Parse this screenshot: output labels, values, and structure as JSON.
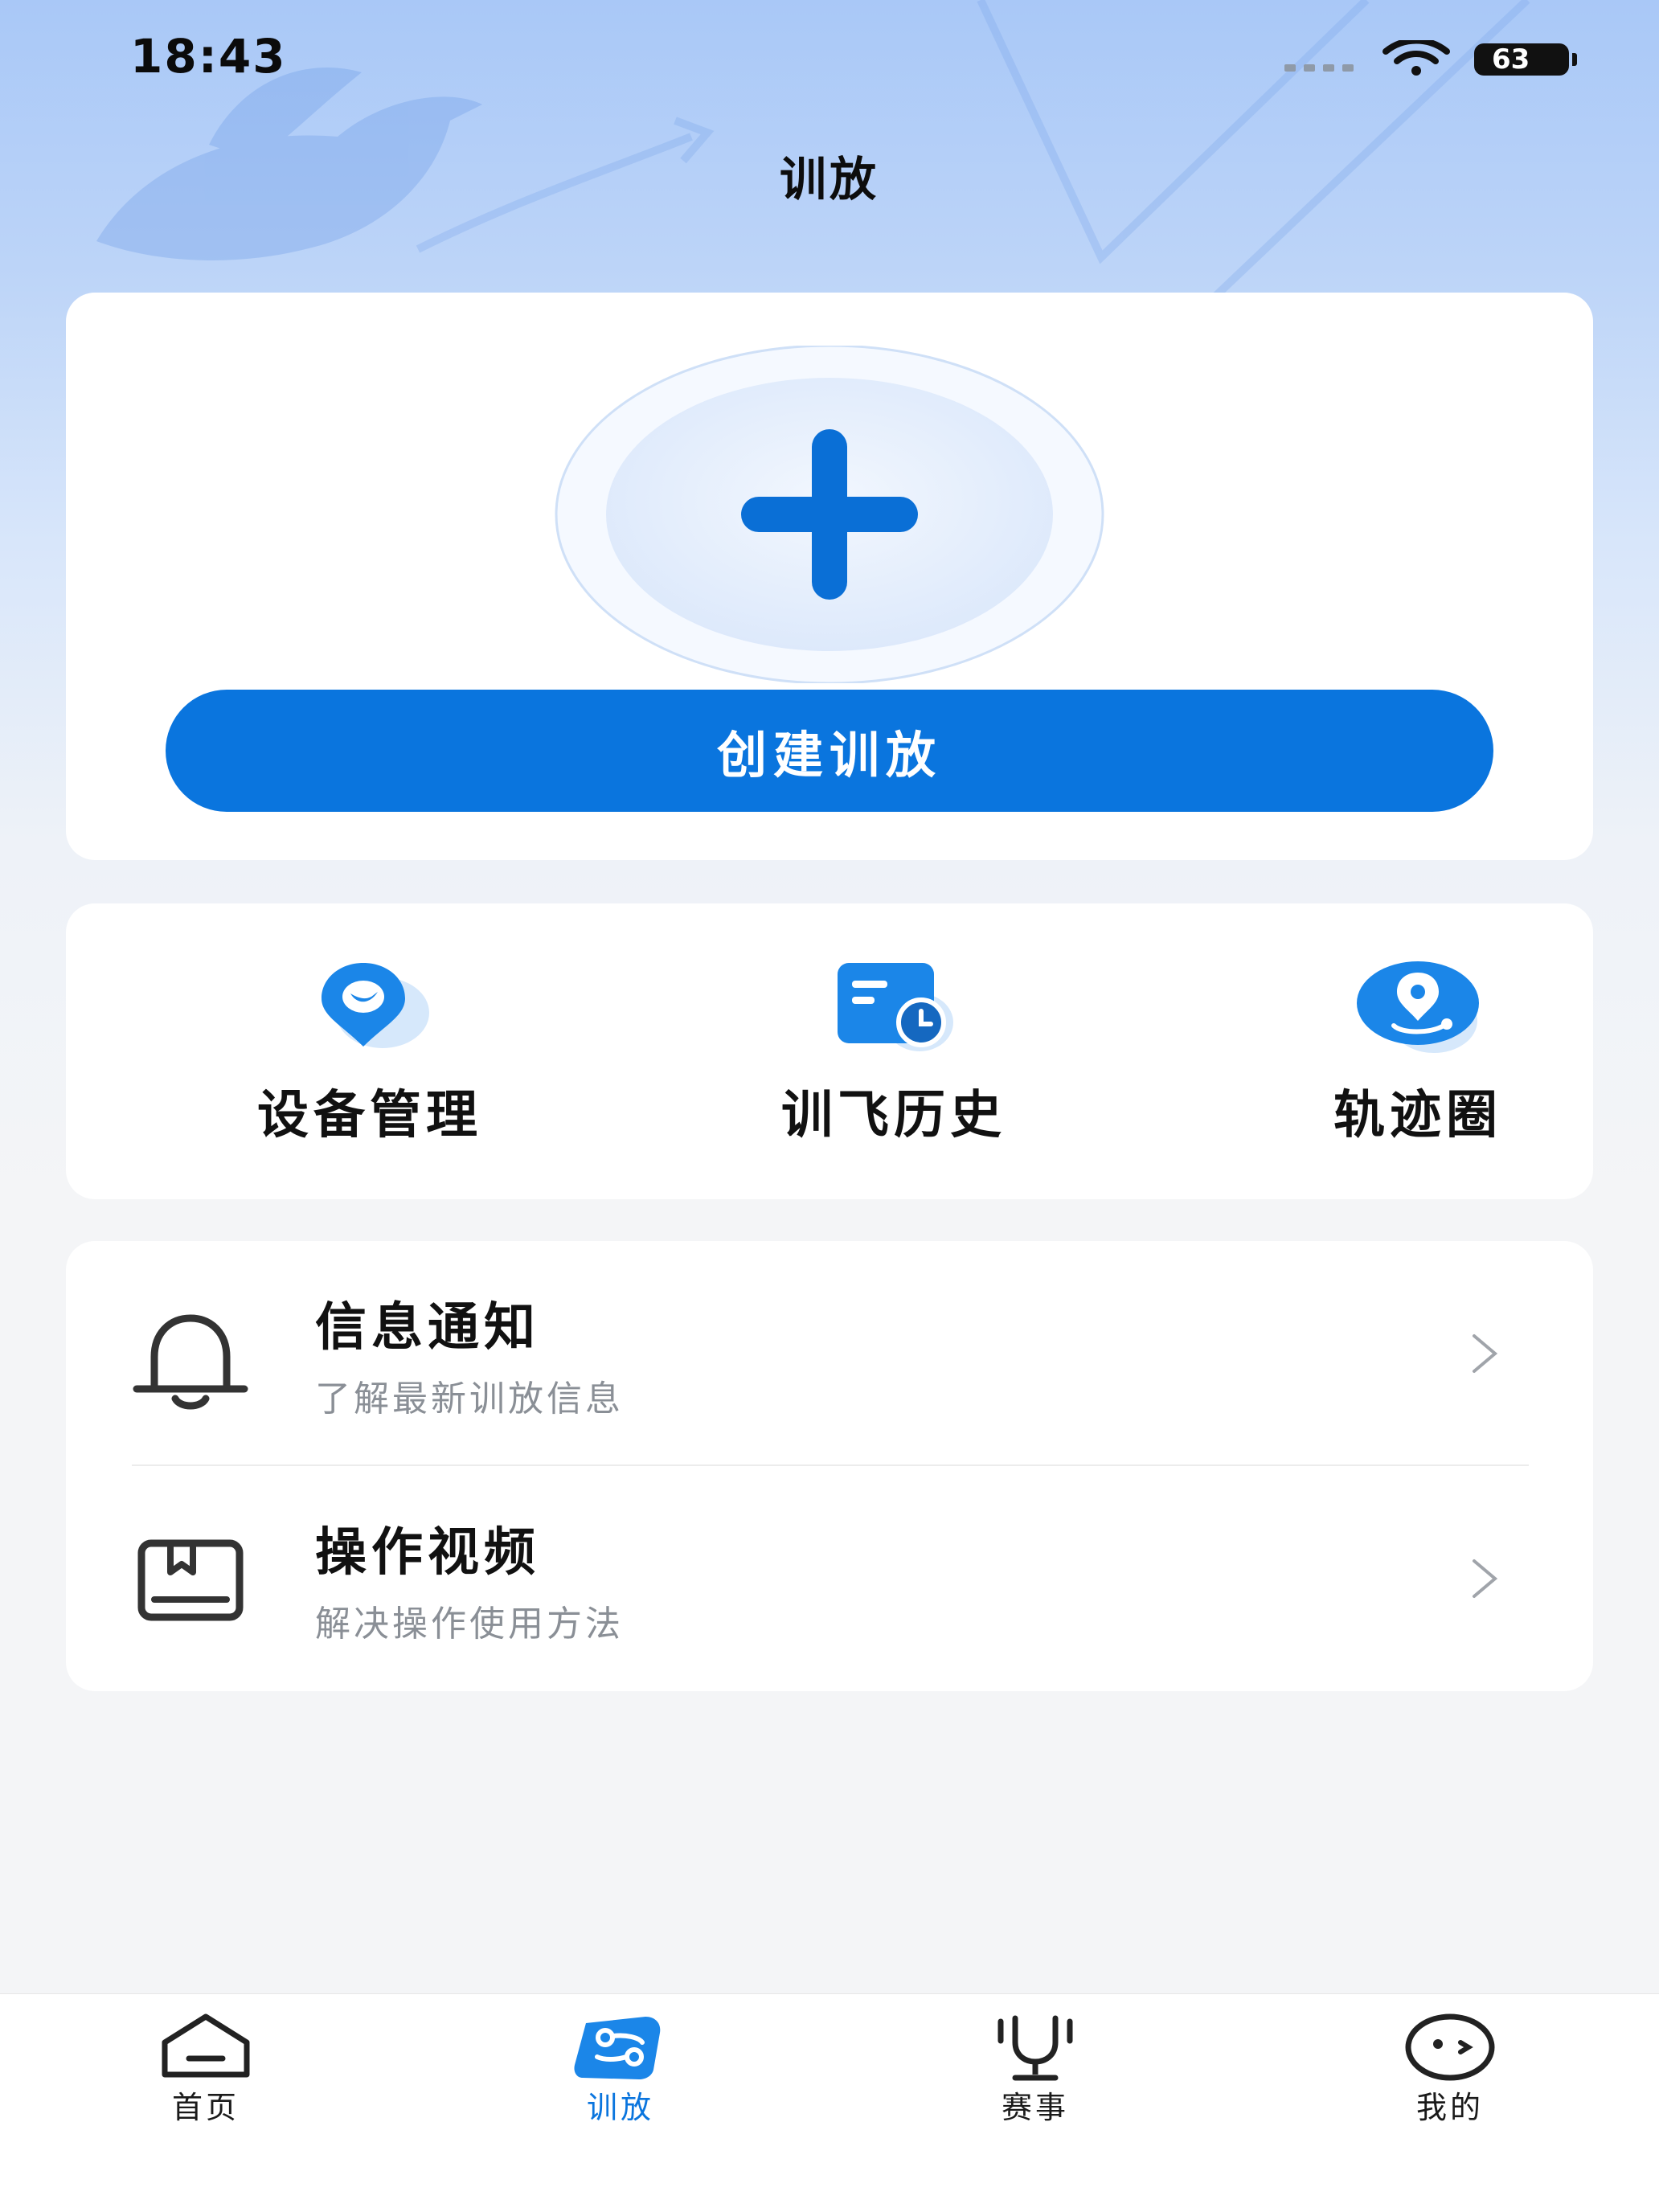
{
  "status_bar": {
    "time": "18:43",
    "battery": "63"
  },
  "header": {
    "title": "训放"
  },
  "create_card": {
    "button_label": "创建训放",
    "icon": "plus-icon"
  },
  "shortcuts": [
    {
      "label": "设备管理",
      "icon": "bird-pin-icon"
    },
    {
      "label": "训飞历史",
      "icon": "history-clock-icon"
    },
    {
      "label": "轨迹圈",
      "icon": "route-pin-icon"
    }
  ],
  "list": [
    {
      "title": "信息通知",
      "subtitle": "了解最新训放信息",
      "icon": "bell-icon"
    },
    {
      "title": "操作视频",
      "subtitle": "解决操作使用方法",
      "icon": "book-icon"
    }
  ],
  "tabbar": [
    {
      "label": "首页",
      "icon": "home-icon",
      "active": false
    },
    {
      "label": "训放",
      "icon": "training-icon",
      "active": true
    },
    {
      "label": "赛事",
      "icon": "trophy-icon",
      "active": false
    },
    {
      "label": "我的",
      "icon": "profile-face-icon",
      "active": false
    }
  ],
  "colors": {
    "accent": "#0a75de",
    "background": "#f4f5f7",
    "header_gradient_top": "#a9c8f7"
  }
}
